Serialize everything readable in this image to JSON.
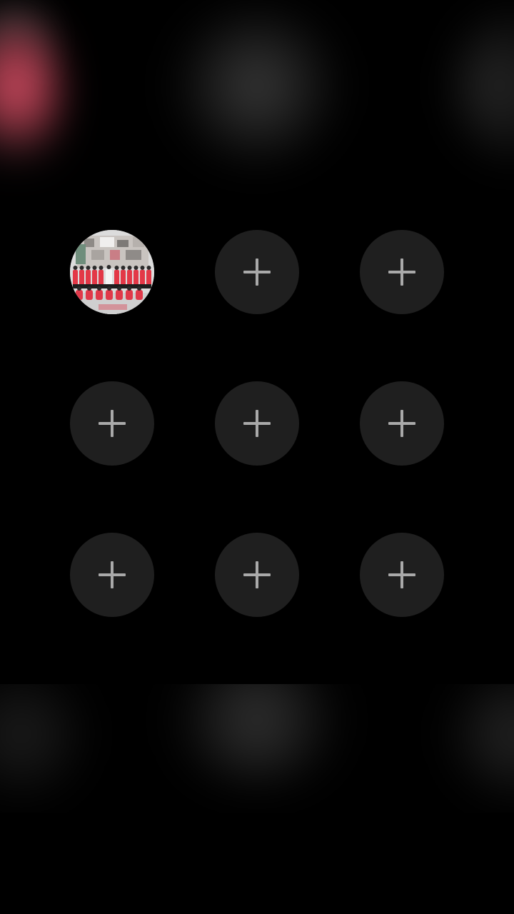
{
  "background": {
    "color": "#000000"
  },
  "grid": {
    "slot_color": "#1f1f1f",
    "icon_color": "#a9a9a9",
    "slots": [
      {
        "type": "photo",
        "icon": "group-photo"
      },
      {
        "type": "add",
        "icon": "plus-icon"
      },
      {
        "type": "add",
        "icon": "plus-icon"
      },
      {
        "type": "add",
        "icon": "plus-icon"
      },
      {
        "type": "add",
        "icon": "plus-icon"
      },
      {
        "type": "add",
        "icon": "plus-icon"
      },
      {
        "type": "add",
        "icon": "plus-icon"
      },
      {
        "type": "add",
        "icon": "plus-icon"
      },
      {
        "type": "add",
        "icon": "plus-icon"
      }
    ]
  }
}
